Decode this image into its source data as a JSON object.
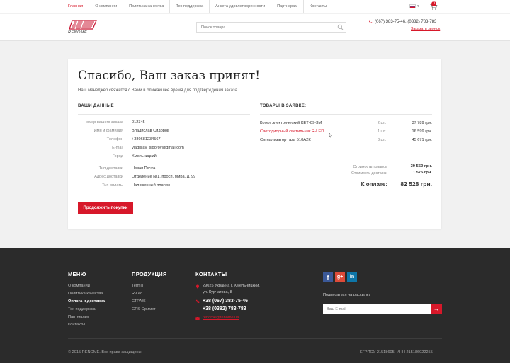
{
  "topnav": {
    "links": [
      "Главная",
      "О компании",
      "Политика качества",
      "Тех поддержка",
      "Анкета удовлетворенности",
      "Партнерам",
      "Контакты"
    ],
    "cart_count": "0"
  },
  "header": {
    "logo_text": "RENOME",
    "search_placeholder": "Поиск товара",
    "phones": "(067) 383-75-46, (0382) 783-783",
    "callback": "Заказать звонок"
  },
  "order": {
    "title": "Спасибо, Ваш заказ принят!",
    "subtitle": "Наш менеджер свяжется с Вами в ближайшее время для подтверждения заказа.",
    "your_data_heading": "ВАШИ ДАННЫЕ",
    "fields": [
      {
        "label": "Номер вашего заказа",
        "value": "012345"
      },
      {
        "label": "Имя и фамилия",
        "value": "Владислав Сидоров"
      },
      {
        "label": "Телефон",
        "value": "+380681234567"
      },
      {
        "label": "E-mail",
        "value": "vladislav_sidorov@gmail.com"
      },
      {
        "label": "Город",
        "value": "Хмельницкий"
      }
    ],
    "delivery": [
      {
        "label": "Тип доставки",
        "value": "Новая Почта"
      },
      {
        "label": "Адрес доставки",
        "value": "Отделение №1, просп. Мира, д. 99"
      },
      {
        "label": "Тип оплаты",
        "value": "Наложенный платеж"
      }
    ],
    "items_heading": "ТОВАРЫ В ЗАЯВКЕ:",
    "items": [
      {
        "name": "Котел электрический КЕТ-09-3М",
        "qty": "2 шт.",
        "price": "37 789 грн."
      },
      {
        "name": "Светодиодный светильник R-LED",
        "qty": "1 шт.",
        "price": "16 599 грн."
      },
      {
        "name": "Сигнализатор газа 510А2К",
        "qty": "3 шт.",
        "price": "45 671 грн."
      }
    ],
    "goods_cost_label": "Стоимость товаров",
    "goods_cost": "39 550 грн.",
    "delivery_cost_label": "Стоимость доставки",
    "delivery_cost": "1 575 грн.",
    "total_label": "К оплате:",
    "total": "82 528 грн.",
    "continue_button": "Продолжить покупки"
  },
  "footer": {
    "menu_heading": "МЕНЮ",
    "menu": [
      "О компании",
      "Политика качества",
      "Оплата и доставка",
      "Тех поддержка",
      "Партнерам",
      "Контакты"
    ],
    "products_heading": "ПРОДУКЦИЯ",
    "products": [
      "TermIT",
      "R-Led",
      "СТРАЖ",
      "GPS-Оримет"
    ],
    "contacts_heading": "КОНТАКТЫ",
    "address_line1": "29025 Украина г. Хмельницкий,",
    "address_line2": "ул. Курчатова, 8",
    "phone1": "+38 (067) 383-75-46",
    "phone2": "+38 (0382) 783-783",
    "email": "renome@renome.ua",
    "social": [
      "f",
      "g+",
      "in"
    ],
    "subscribe_label": "Подписаться на рассылку",
    "email_placeholder": "Ваш E-mail",
    "copyright": "© 2015 RENOME. Все права защищены",
    "edrpou": "ЕГРПОУ 21518605,  ИНН 215186022255"
  },
  "colors": {
    "accent": "#d7182a",
    "footer_bg": "#2b2b2b",
    "page_bg": "#f1f1f1"
  }
}
